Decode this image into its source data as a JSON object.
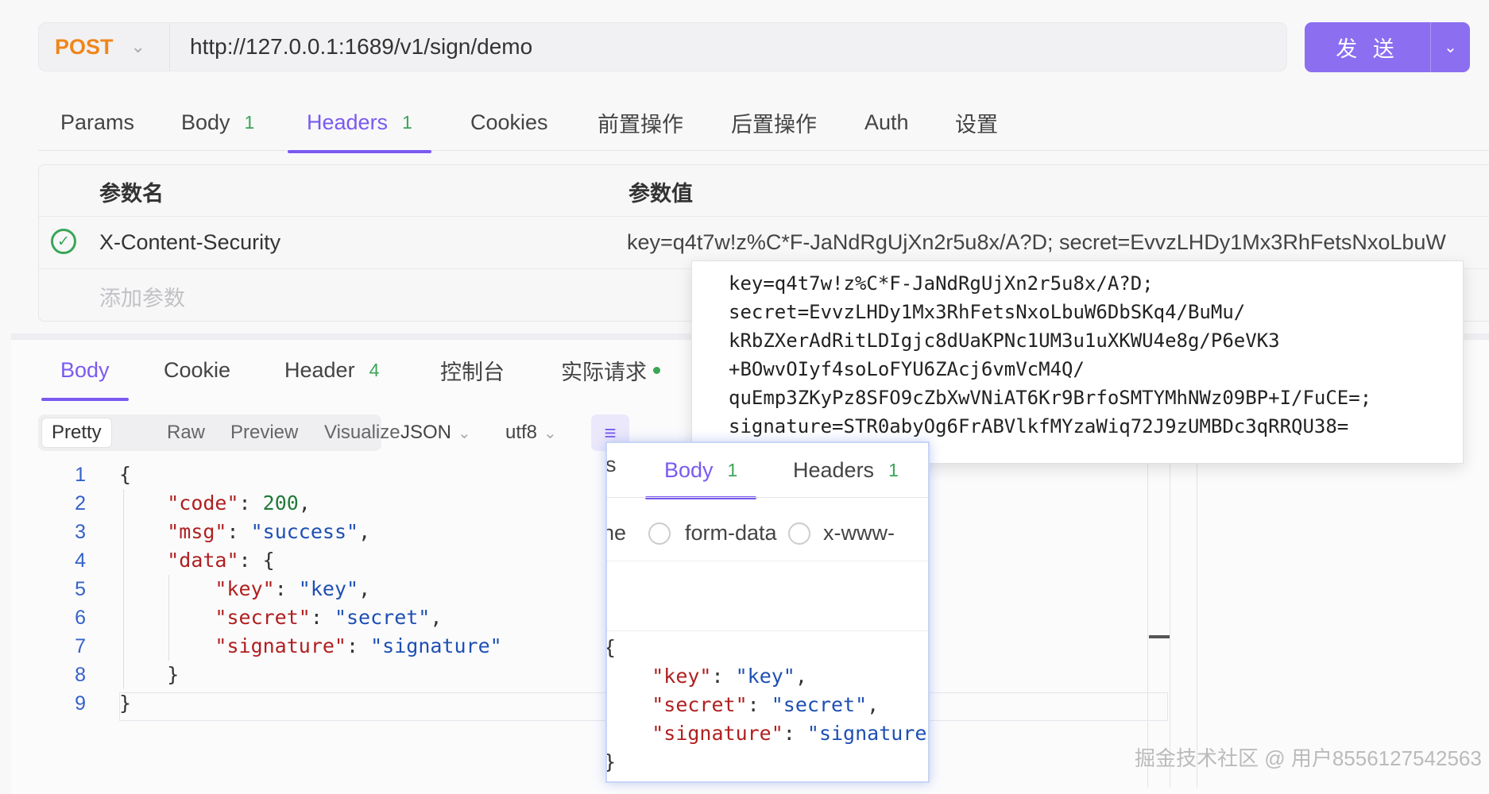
{
  "request": {
    "method": "POST",
    "url": "http://127.0.0.1:1689/v1/sign/demo",
    "send_label": "发 送"
  },
  "request_tabs": [
    {
      "label": "Params",
      "count": ""
    },
    {
      "label": "Body",
      "count": "1"
    },
    {
      "label": "Headers",
      "count": "1"
    },
    {
      "label": "Cookies",
      "count": ""
    },
    {
      "label": "前置操作",
      "count": ""
    },
    {
      "label": "后置操作",
      "count": ""
    },
    {
      "label": "Auth",
      "count": ""
    },
    {
      "label": "设置",
      "count": ""
    }
  ],
  "params_table": {
    "col_name": "参数名",
    "col_value": "参数值",
    "row_name": "X-Content-Security",
    "row_value": "key=q4t7w!z%C*F-JaNdRgUjXn2r5u8x/A?D; secret=EvvzLHDy1Mx3RhFetsNxoLbuW",
    "add_placeholder": "添加参数"
  },
  "tooltip_lines": [
    "key=q4t7w!z%C*F-JaNdRgUjXn2r5u8x/A?D;",
    "secret=EvvzLHDy1Mx3RhFetsNxoLbuW6DbSKq4/BuMu/",
    "kRbZXerAdRitLDIgjc8dUaKPNc1UM3u1uXKWU4e8g/P6eVK3",
    "+BOwvOIyf4soLoFYU6ZAcj6vmVcM4Q/",
    "quEmp3ZKyPz8SFO9cZbXwVNiAT6Kr9BrfoSMTYMhNWz09BP+I/FuCE=;",
    "signature=STR0abyOg6FrABVlkfMYzaWiq72J9zUMBDc3qRRQU38="
  ],
  "response_tabs": [
    {
      "label": "Body",
      "count": ""
    },
    {
      "label": "Cookie",
      "count": ""
    },
    {
      "label": "Header",
      "count": "4"
    },
    {
      "label": "控制台",
      "count": ""
    },
    {
      "label": "实际请求",
      "count": ""
    }
  ],
  "format_options": [
    "Pretty",
    "Raw",
    "Preview",
    "Visualize"
  ],
  "format_lang": "JSON",
  "encoding": "utf8",
  "line_numbers": [
    "1",
    "2",
    "3",
    "4",
    "5",
    "6",
    "7",
    "8",
    "9"
  ],
  "code": {
    "l1": "{",
    "code_key": "\"code\"",
    "code_val": "200",
    "msg_key": "\"msg\"",
    "msg_val": "\"success\"",
    "data_key": "\"data\"",
    "key_key": "\"key\"",
    "key_val": "\"key\"",
    "secret_key": "\"secret\"",
    "secret_val": "\"secret\"",
    "sig_key": "\"signature\"",
    "sig_val": "\"signature\"",
    "close_inner": "}",
    "close_outer": "}"
  },
  "card": {
    "partial_tab": "s",
    "tab_body": "Body",
    "tab_body_count": "1",
    "tab_headers": "Headers",
    "tab_headers_count": "1",
    "partial_left": "ne",
    "radio1": "form-data",
    "radio2": "x-www-",
    "open": "{",
    "close": "}"
  },
  "watermark": "掘金技术社区 @ 用户8556127542563",
  "colors": {
    "accent": "#7a5af0",
    "send_button": "#8b6ff0",
    "method": "#f0861a",
    "count_green": "#3aa657"
  }
}
